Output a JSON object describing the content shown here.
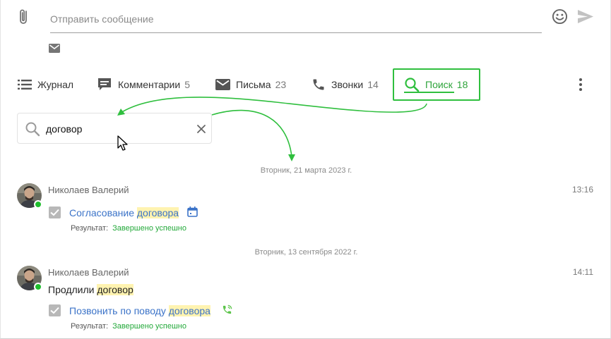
{
  "composer": {
    "placeholder": "Отправить сообщение"
  },
  "tabs": [
    {
      "label": "Журнал",
      "count": ""
    },
    {
      "label": "Комментарии",
      "count": "5"
    },
    {
      "label": "Письма",
      "count": "23"
    },
    {
      "label": "Звонки",
      "count": "14"
    },
    {
      "label": "Поиск",
      "count": "18"
    }
  ],
  "search": {
    "value": "договор"
  },
  "feed": {
    "groups": [
      {
        "date": "Вторник, 21 марта 2023 г.",
        "entries": [
          {
            "author": "Николаев Валерий",
            "time": "13:16",
            "task_before": "Согласование ",
            "task_highlight": "договора",
            "result_label": "Результат:",
            "result_value": "Завершено успешно"
          }
        ]
      },
      {
        "date": "Вторник, 13 сентября 2022 г.",
        "entries": [
          {
            "author": "Николаев Валерий",
            "time": "14:11",
            "text_before": "Продлили ",
            "text_highlight": "договор",
            "task_before": "Позвонить по поводу ",
            "task_highlight": "договора",
            "result_label": "Результат:",
            "result_value": "Завершено успешно"
          }
        ]
      }
    ]
  },
  "colors": {
    "accent": "#2fbf3e",
    "link": "#3b73c8",
    "highlight": "#fff3b0",
    "online": "#1fbe2e"
  }
}
